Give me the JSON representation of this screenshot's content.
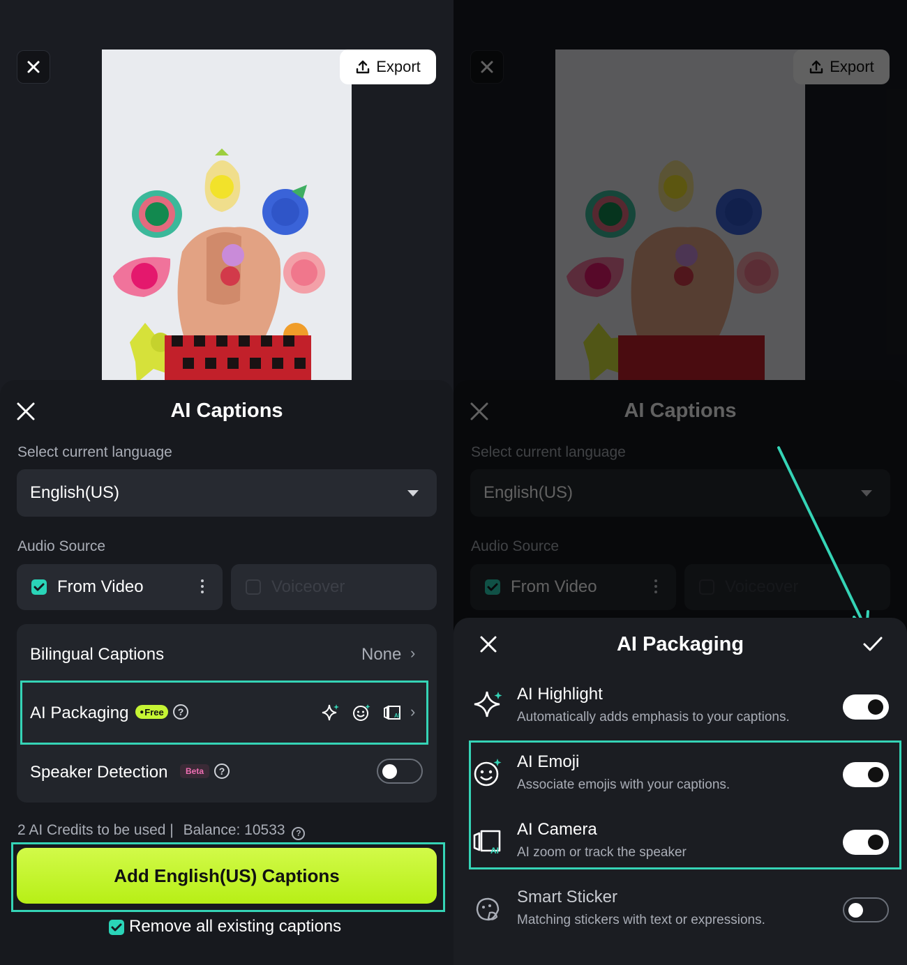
{
  "colors": {
    "accent_teal": "#35d4b6",
    "primary_button": "#c6f534",
    "panel_bg": "#17191e",
    "beta_pink": "#f06fb4"
  },
  "top_bar": {
    "close_icon": "close-icon",
    "export_label": "Export",
    "export_icon": "upload-icon"
  },
  "ai_captions": {
    "title": "AI Captions",
    "language_label": "Select current language",
    "language_value": "English(US)",
    "audio_source_label": "Audio Source",
    "sources": [
      {
        "label": "From Video",
        "checked": true
      },
      {
        "label": "Voiceover",
        "checked": false
      }
    ],
    "bilingual_label": "Bilingual Captions",
    "bilingual_value": "None",
    "packaging_label": "AI Packaging",
    "free_badge": "Free",
    "speaker_label": "Speaker Detection",
    "beta_badge": "Beta",
    "credits_text": "2 AI Credits to be used |",
    "balance_text": "Balance: 10533",
    "add_button": "Add English(US) Captions",
    "remove_label": "Remove all existing captions",
    "remove_checked": true,
    "speaker_detection_on": false
  },
  "ai_packaging": {
    "title": "AI Packaging",
    "items": [
      {
        "title": "AI Highlight",
        "desc": "Automatically adds emphasis to your captions.",
        "icon": "sparkle-icon",
        "on": true
      },
      {
        "title": "AI Emoji",
        "desc": "Associate emojis with your captions.",
        "icon": "smile-sparkle-icon",
        "on": true
      },
      {
        "title": "AI Camera",
        "desc": "AI zoom or track the speaker",
        "icon": "ai-camera-icon",
        "on": true
      },
      {
        "title": "Smart Sticker",
        "desc": "Matching stickers with text or expressions.",
        "icon": "sticker-icon",
        "on": false
      }
    ]
  }
}
